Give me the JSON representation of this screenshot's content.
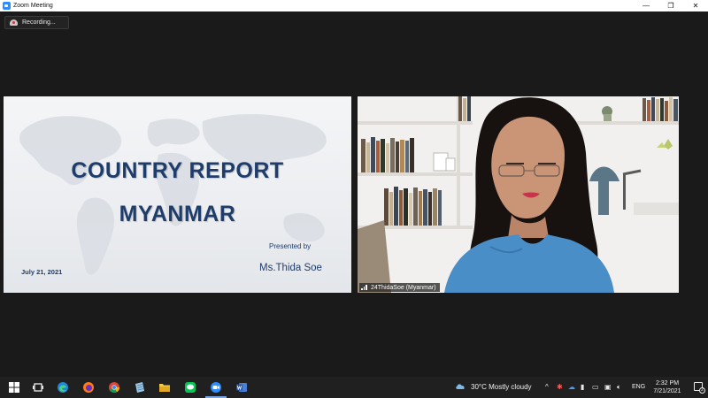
{
  "window": {
    "title": "Zoom Meeting",
    "controls": {
      "minimize": "—",
      "maximize": "❐",
      "close": "✕"
    }
  },
  "recording": {
    "label": "Recording...",
    "icon": "cloud-recording-icon"
  },
  "slide": {
    "title_line1": "COUNTRY REPORT",
    "title_line2": "MYANMAR",
    "presented_by": "Presented by",
    "presenter": "Ms.Thida Soe",
    "date": "July 21, 2021",
    "title_color": "#1f3d6b"
  },
  "video": {
    "participant_name": "24ThidaSoe (Myanmar)",
    "signal_icon": "signal-strength-icon"
  },
  "taskbar": {
    "icons": [
      "windows-start-icon",
      "task-view-icon",
      "edge-icon",
      "firefox-icon",
      "chrome-icon",
      "notepad-icon",
      "file-explorer-icon",
      "line-icon",
      "zoom-icon",
      "word-icon"
    ],
    "weather": "30°C  Mostly cloudy",
    "language": "ENG",
    "time": "2:32 PM",
    "date": "7/21/2021",
    "notifications": "2"
  },
  "colors": {
    "zoom_blue": "#2d8cff",
    "background": "#1a1a1a",
    "taskbar": "#202020"
  }
}
